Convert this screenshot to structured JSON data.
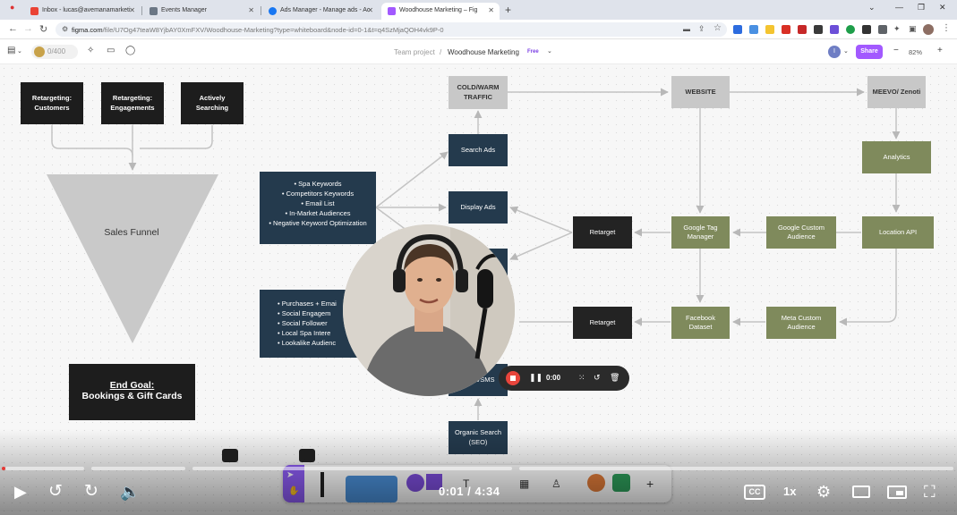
{
  "browser": {
    "tabs": [
      {
        "label": "Inbox - lucas@avemanamarketi",
        "color": "#ea4335"
      },
      {
        "label": "Events Manager",
        "color": "#6b7785"
      },
      {
        "label": "Ads Manager - Manage ads - Ac",
        "color": "#1877f2"
      },
      {
        "label": "Woodhouse Marketing – Fig",
        "color": "#a259ff"
      }
    ],
    "address": {
      "host": "figma.com",
      "path": "/file/U7Og47teaW8YjbAY0XmFXV/Woodhouse-Marketing?type=whiteboard&node-id=0-1&t=q4SzMjaQOH4vk9P-0"
    }
  },
  "figma": {
    "pill_text": "0/400",
    "breadcrumb_team": "Team project",
    "breadcrumb_sep": "/",
    "file_name": "Woodhouse Marketing",
    "plan_badge": "Free",
    "avatar_initial": "I",
    "share_label": "Share",
    "zoom": "82%"
  },
  "board": {
    "retargeting_customers": "Retargeting: Customers",
    "retargeting_engagements": "Retargeting: Engagements",
    "actively_searching": "Actively Searching",
    "sales_funnel": "Sales Funnel",
    "end_goal_title": "End Goal:",
    "end_goal_text": "Bookings & Gift Cards",
    "keywords": [
      "Spa Keywords",
      "Competitors Keywords",
      "Email List",
      "In-Market Audiences",
      "Negative Keyword Optimization"
    ],
    "audiences": [
      "Purchases + Emai",
      "Social Engagem",
      "Social Follower",
      "Local Spa Intere",
      "Lookalike Audienc"
    ],
    "cold_warm_traffic": "COLD/WARM TRAFFIC",
    "search_ads": "Search Ads",
    "display_ads": "Display Ads",
    "email_sms": "l/SMS",
    "organic_search": "Organic Search (SEO)",
    "website": "WEBSITE",
    "meevo": "MEEVO/ Zenoti",
    "analytics": "Analytics",
    "location_api": "Location API",
    "google_custom_audience": "Google Custom Audience",
    "google_tag_manager": "Google Tag Manager",
    "retarget_1": "Retarget",
    "retarget_2": "Retarget",
    "facebook_dataset": "Facebook Dataset",
    "meta_custom_audience": "Meta Custom Audience"
  },
  "recorder": {
    "timer": "0:00"
  },
  "player": {
    "current_time": "0:01",
    "separator": "/",
    "duration": "4:34",
    "cc_label": "CC",
    "speed_label": "1x",
    "progress_played": 0.004
  },
  "colors": {
    "figma_accent": "#a259ff",
    "node_navy": "#243a4d",
    "node_olive": "#7f8a5c",
    "node_grey": "#c8c8c8",
    "record_red": "#e8453c",
    "progress_red": "#e53935"
  }
}
